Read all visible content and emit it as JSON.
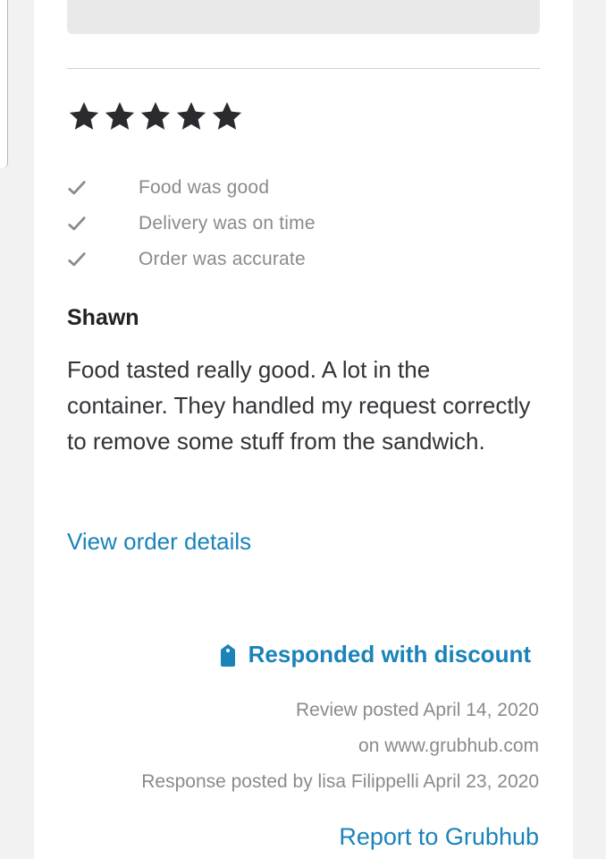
{
  "review": {
    "rating": 5,
    "rating_max": 5,
    "checks": [
      {
        "label": "Food was good"
      },
      {
        "label": "Delivery was on time"
      },
      {
        "label": "Order was accurate"
      }
    ],
    "reviewer_name": "Shawn",
    "text": "Food tasted really good. A lot in the container. They handled my request correctly to remove some stuff from the sandwich.",
    "view_order_label": "View order details",
    "response_status": "Responded with discount",
    "posted_date": "Review posted April 14, 2020",
    "posted_site": "on www.grubhub.com",
    "response_info": "Response posted by lisa Filippelli April 23, 2020",
    "report_label": "Report to Grubhub"
  },
  "icons": {
    "star": "star-icon",
    "check": "checkmark-icon",
    "tag": "tag-icon"
  },
  "colors": {
    "link": "#1a83b8",
    "star": "#2b2b2f",
    "muted": "#8a8a8f",
    "text": "#333338"
  }
}
